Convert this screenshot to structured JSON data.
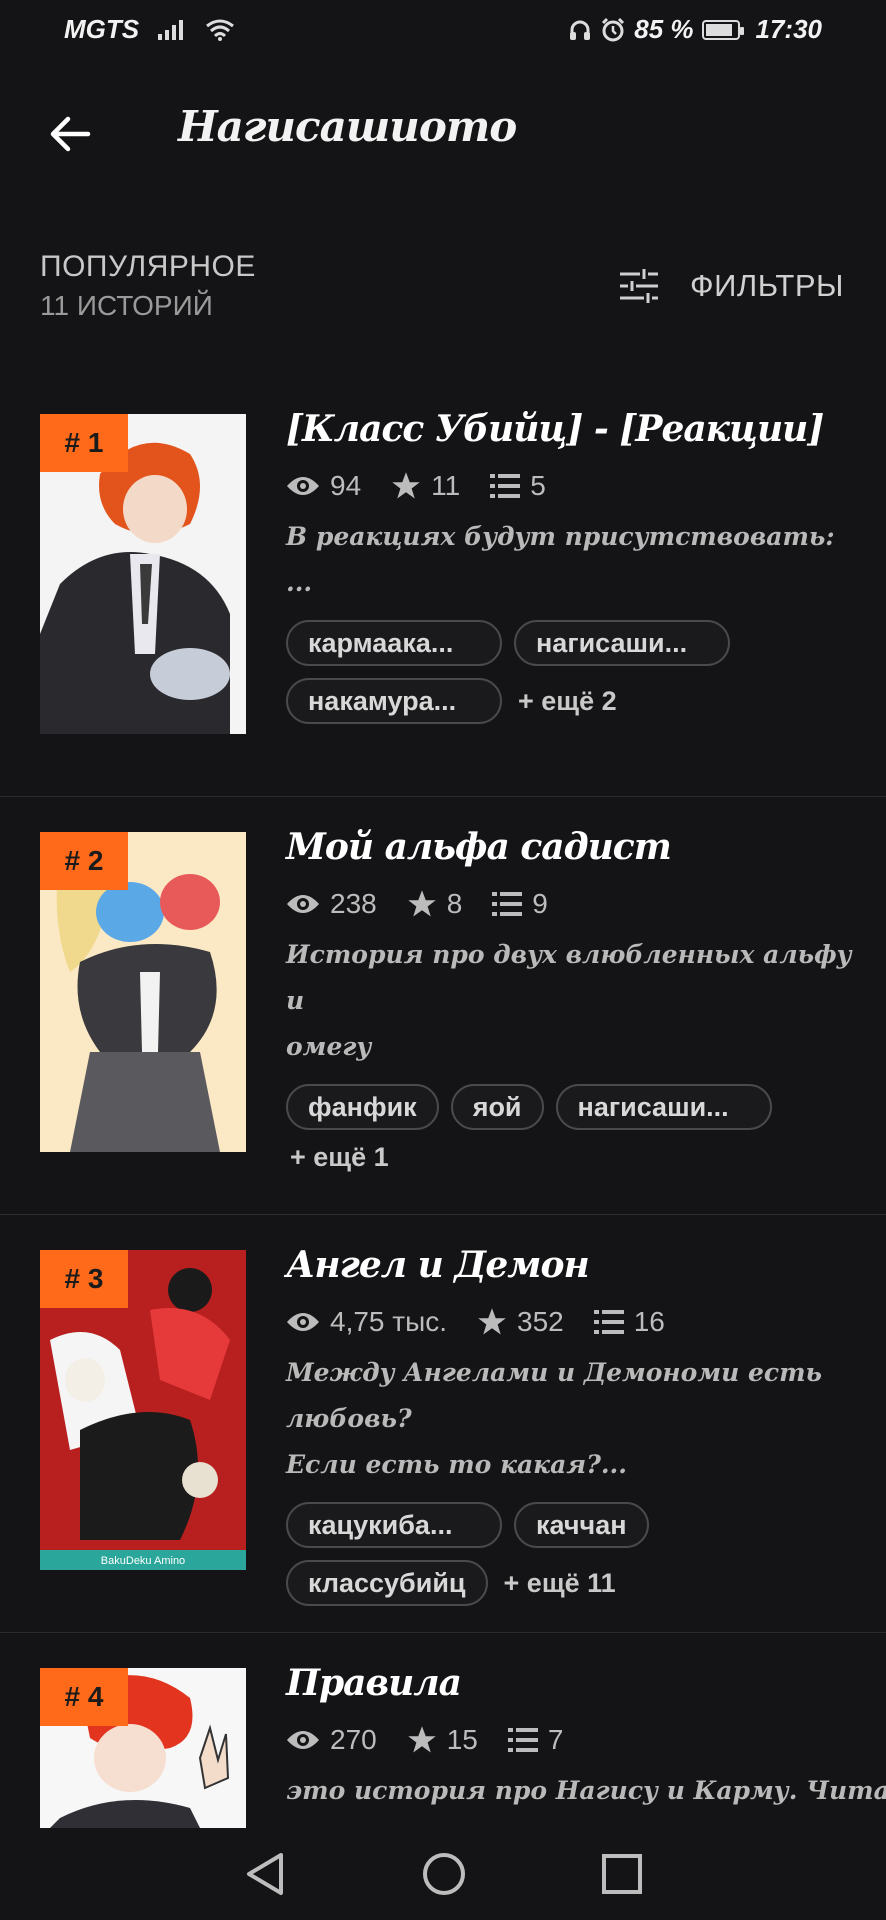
{
  "status_bar": {
    "carrier": "MGTS",
    "battery_percent": "85 %",
    "time": "17:30"
  },
  "header": {
    "title": "Нагисашиото"
  },
  "section": {
    "title": "ПОПУЛЯРНОЕ",
    "count": "11 ИСТОРИЙ",
    "filters_label": "ФИЛЬТРЫ"
  },
  "stories": [
    {
      "rank": "# 1",
      "title": "[Класс Убийц] - [Реакции]",
      "views": "94",
      "stars": "11",
      "parts": "5",
      "description": [
        "В реакциях будут присутствовать:",
        "..."
      ],
      "tags": [
        "кармаака...",
        "нагисаши...",
        "накамура..."
      ],
      "more": "+ ещё 2"
    },
    {
      "rank": "# 2",
      "title": "Мой альфа садист",
      "views": "238",
      "stars": "8",
      "parts": "9",
      "description": [
        "История про двух влюбленных альфу и",
        "омегу"
      ],
      "tags": [
        "фанфик",
        "яой",
        "нагисаши..."
      ],
      "more": "+ ещё 1"
    },
    {
      "rank": "# 3",
      "title": "Ангел и Демон",
      "views": "4,75 тыс.",
      "stars": "352",
      "parts": "16",
      "description": [
        "Между Ангелами и Демономи есть любовь?",
        "Если есть то какая?..."
      ],
      "tags": [
        "кацукиба...",
        "каччан",
        "классубийц"
      ],
      "more": "+ ещё 11",
      "cover_caption": "BakuDeku Amino"
    },
    {
      "rank": "# 4",
      "title": "Правила",
      "views": "270",
      "stars": "15",
      "parts": "7",
      "description": [
        "это история про Нагису и Карму. Читайте"
      ]
    }
  ],
  "colors": {
    "background": "#141315",
    "rank_badge": "#ff6a1a",
    "text_primary": "#ffffff"
  }
}
